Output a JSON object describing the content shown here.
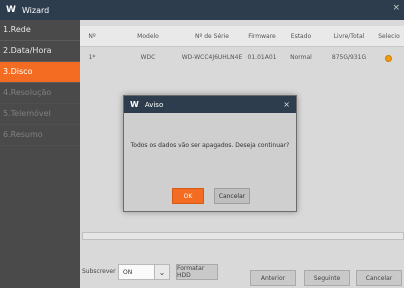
{
  "window": {
    "title": "Wizard",
    "logo": "W",
    "close_glyph": "×"
  },
  "sidebar": {
    "items": [
      {
        "label": "1.Rede",
        "state": "normal"
      },
      {
        "label": "2.Data/Hora",
        "state": "normal"
      },
      {
        "label": "3.Disco",
        "state": "active"
      },
      {
        "label": "4.Resolução",
        "state": "disabled"
      },
      {
        "label": "5.Telemóvel",
        "state": "disabled"
      },
      {
        "label": "6.Resumo",
        "state": "disabled"
      }
    ]
  },
  "table": {
    "headers": [
      "Nº",
      "Modelo",
      "Nº de Série",
      "Firmware",
      "Estado",
      "Livre/Total",
      "Selecio"
    ],
    "rows": [
      [
        "1*",
        "WDC",
        "WD-WCC4J6UHLN4E",
        "01.01A01",
        "Normal",
        "875G/931G",
        ""
      ]
    ]
  },
  "controls": {
    "subscrever_label": "Subscrever",
    "subscrever_value": "ON",
    "format_button": "Formatar HDD",
    "back_button": "Anterior",
    "next_button": "Seguinte",
    "cancel_button": "Cancelar"
  },
  "dialog": {
    "title": "Aviso",
    "logo": "W",
    "close_glyph": "×",
    "message": "Todos os dados vão ser apagados. Deseja continuar?",
    "ok_label": "OK",
    "cancel_label": "Cancelar"
  },
  "colors": {
    "accent": "#f36c21",
    "titlebar": "#2d3d4e",
    "radio_selected": "#f39c12"
  }
}
